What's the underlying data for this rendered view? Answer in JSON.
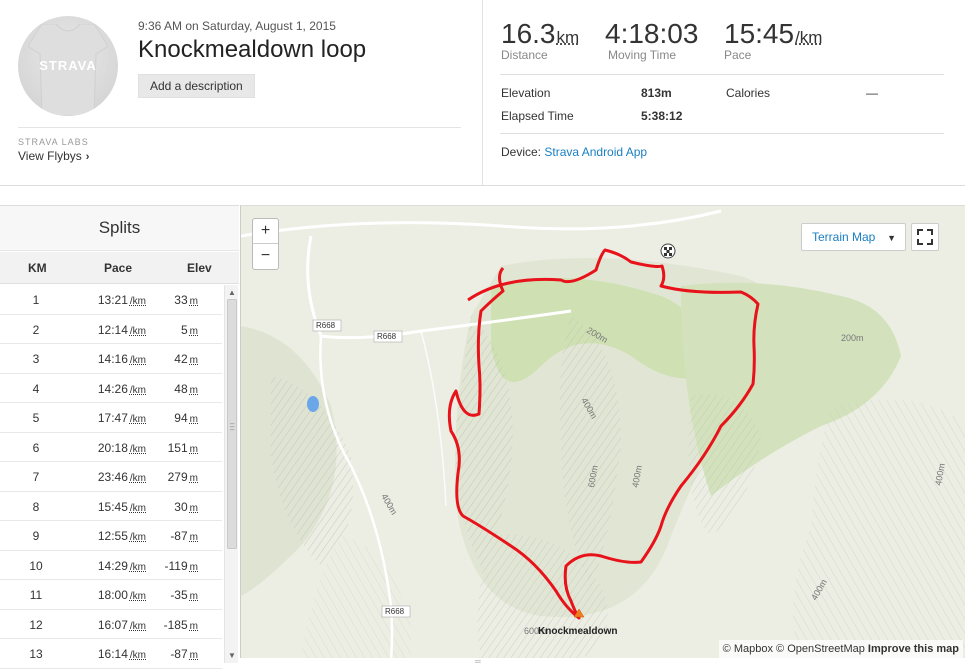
{
  "activity": {
    "datetime": "9:36 AM on Saturday, August 1, 2015",
    "title": "Knockmealdown loop",
    "add_description": "Add a description",
    "avatar_logo": "STRAVA"
  },
  "labs": {
    "label": "STRAVA LABS",
    "flybys": "View Flybys",
    "chevron": "›"
  },
  "stats": {
    "distance": {
      "value": "16.3",
      "unit": "km",
      "label": "Distance"
    },
    "moving_time": {
      "value": "4:18:03",
      "label": "Moving Time"
    },
    "pace": {
      "value": "15:45",
      "unit": "/km",
      "label": "Pace"
    }
  },
  "more": {
    "elevation_label": "Elevation",
    "elevation_value": "813m",
    "calories_label": "Calories",
    "calories_value": "—",
    "elapsed_label": "Elapsed Time",
    "elapsed_value": "5:38:12"
  },
  "device": {
    "label": "Device:",
    "value": "Strava Android App"
  },
  "splits": {
    "title": "Splits",
    "headers": {
      "km": "KM",
      "pace": "Pace",
      "elev": "Elev"
    },
    "pace_unit": "/km",
    "elev_unit": "m",
    "rows": [
      {
        "km": "1",
        "pace": "13:21",
        "elev": "33"
      },
      {
        "km": "2",
        "pace": "12:14",
        "elev": "5"
      },
      {
        "km": "3",
        "pace": "14:16",
        "elev": "42"
      },
      {
        "km": "4",
        "pace": "14:26",
        "elev": "48"
      },
      {
        "km": "5",
        "pace": "17:47",
        "elev": "94"
      },
      {
        "km": "6",
        "pace": "20:18",
        "elev": "151"
      },
      {
        "km": "7",
        "pace": "23:46",
        "elev": "279"
      },
      {
        "km": "8",
        "pace": "15:45",
        "elev": "30"
      },
      {
        "km": "9",
        "pace": "12:55",
        "elev": "-87"
      },
      {
        "km": "10",
        "pace": "14:29",
        "elev": "-119"
      },
      {
        "km": "11",
        "pace": "18:00",
        "elev": "-35"
      },
      {
        "km": "12",
        "pace": "16:07",
        "elev": "-185"
      },
      {
        "km": "13",
        "pace": "16:14",
        "elev": "-87"
      }
    ]
  },
  "map": {
    "zoom_in": "+",
    "zoom_out": "−",
    "terrain_button": "Terrain Map",
    "peak_label": "Knockmealdown",
    "road_labels": [
      "R668",
      "R668",
      "R668"
    ],
    "contour_labels": [
      "200m",
      "200m",
      "400m",
      "600m",
      "400m",
      "400m",
      "400m",
      "600m",
      "400m"
    ],
    "attribution": {
      "mapbox": "© Mapbox",
      "osm": "© OpenStreetMap",
      "improve": "Improve this map"
    },
    "route_color": "#e8121a"
  }
}
